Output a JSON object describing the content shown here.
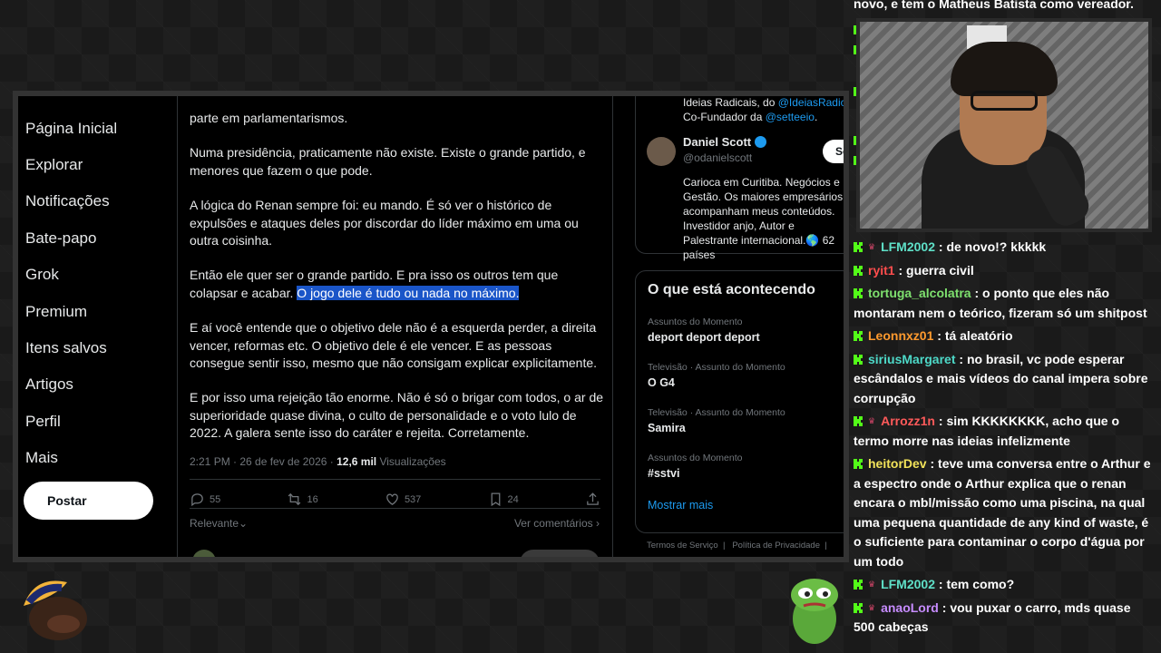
{
  "nav": {
    "items": [
      {
        "label": "Página Inicial"
      },
      {
        "label": "Explorar"
      },
      {
        "label": "Notificações"
      },
      {
        "label": "Bate-papo"
      },
      {
        "label": "Grok"
      },
      {
        "label": "Premium"
      },
      {
        "label": "Itens salvos"
      },
      {
        "label": "Artigos"
      },
      {
        "label": "Perfil"
      },
      {
        "label": "Mais"
      }
    ],
    "post_button": "Postar"
  },
  "tweet": {
    "paragraphs": [
      "parte em parlamentarismos.",
      "Numa presidência, praticamente não existe. Existe o grande partido, e menores que fazem o que pode.",
      "A lógica do Renan sempre foi: eu mando. É só ver o histórico de expulsões e ataques deles por discordar do líder máximo em uma ou outra coisinha.",
      "Então ele quer ser o grande partido. E pra isso os outros tem que colapsar e acabar.",
      "O jogo dele é tudo ou nada no máximo.",
      "E aí você entende que o objetivo dele não é a esquerda perder, a direita vencer, reformas etc. O objetivo dele é ele vencer. E as pessoas consegue sentir isso, mesmo que não consigam explicar explicitamente.",
      "E por isso uma rejeição tão enorme. Não é só o brigar com todos, o ar de superioridade quase divina, o culto de personalidade e o voto lulo de 2022. A galera sente isso do caráter e rejeita. Corretamente."
    ],
    "timestamp": "2:21 PM · 26 de fev de 2026 · ",
    "views_count": "12,6 mil",
    "views_label": " Visualizações",
    "actions": {
      "replies": "55",
      "reposts": "16",
      "likes": "537",
      "bookmarks": "24"
    },
    "sort_label": "Relevante",
    "see_comments": "Ver comentários"
  },
  "who_to_follow": {
    "prev_line1_prefix": "Ideias Radicais, do ",
    "prev_line1_link": "@IdeiasRadicais",
    "prev_line2_prefix": "Co-Fundador da ",
    "prev_line2_link": "@setteeio",
    "prev_line2_suffix": ".",
    "name": "Daniel Scott",
    "handle": "@odanielscott",
    "follow_label": "Se",
    "bio": "Carioca em Curitiba. Negócios e Gestão. Os maiores empresários acompanham meus conteúdos. Investidor anjo, Autor e Palestrante internacional.🌎 62 países"
  },
  "trending": {
    "header": "O que está acontecendo",
    "items": [
      {
        "category": "Assuntos do Momento",
        "name": "deport deport deport"
      },
      {
        "category": "Televisão · Assunto do Momento",
        "name": "O G4"
      },
      {
        "category": "Televisão · Assunto do Momento",
        "name": "Samira"
      },
      {
        "category": "Assuntos do Momento",
        "name": "#sstvi"
      }
    ],
    "show_more": "Mostrar mais"
  },
  "footer": {
    "links": [
      "Termos de Serviço",
      "Política de Privacidade"
    ]
  },
  "chat": {
    "top_line": "novo, e tem o Matheus Batista como vereador.",
    "messages": [
      {
        "user": "LFM2002",
        "color": "#5fe0c8",
        "text": "de novo!? kkkkk",
        "crown": true
      },
      {
        "user": "ryit1",
        "color": "#ff4d4d",
        "text": "guerra civil",
        "crown": false
      },
      {
        "user": "tortuga_alcolatra",
        "color": "#7ee06e",
        "text": "o ponto que eles não montaram nem o teórico, fizeram só um shitpost",
        "crown": false
      },
      {
        "user": "Leonnxz01",
        "color": "#ff9a2e",
        "text": "tá aleatório",
        "crown": false
      },
      {
        "user": "siriusMargaret",
        "color": "#4dd9c8",
        "text": "no brasil, vc pode esperar escândalos e mais vídeos do canal impera sobre corrupção",
        "crown": false
      },
      {
        "user": "Arrozz1n",
        "color": "#ff5a5a",
        "text": "sim KKKKKKKK, acho que o termo morre nas ideias infelizmente",
        "crown": true
      },
      {
        "user": "heitorDev",
        "color": "#f2e35a",
        "text": "teve uma conversa entre o Arthur e a espectro onde o Arthur explica que o renan encara o mbl/missão como uma piscina, na qual uma pequena quantidade de any kind of waste, é o suficiente para contaminar o corpo d'água por um todo",
        "crown": false
      },
      {
        "user": "LFM2002",
        "color": "#5fe0c8",
        "text": "tem como?",
        "crown": true
      },
      {
        "user": "anaoLord",
        "color": "#c78cff",
        "text": "vou puxar o carro, mds quase 500 cabeças",
        "crown": true
      }
    ]
  },
  "colors": {
    "accent": "#1d9bf0",
    "highlight": "#1a55c8",
    "kick_green": "#53fc18"
  }
}
